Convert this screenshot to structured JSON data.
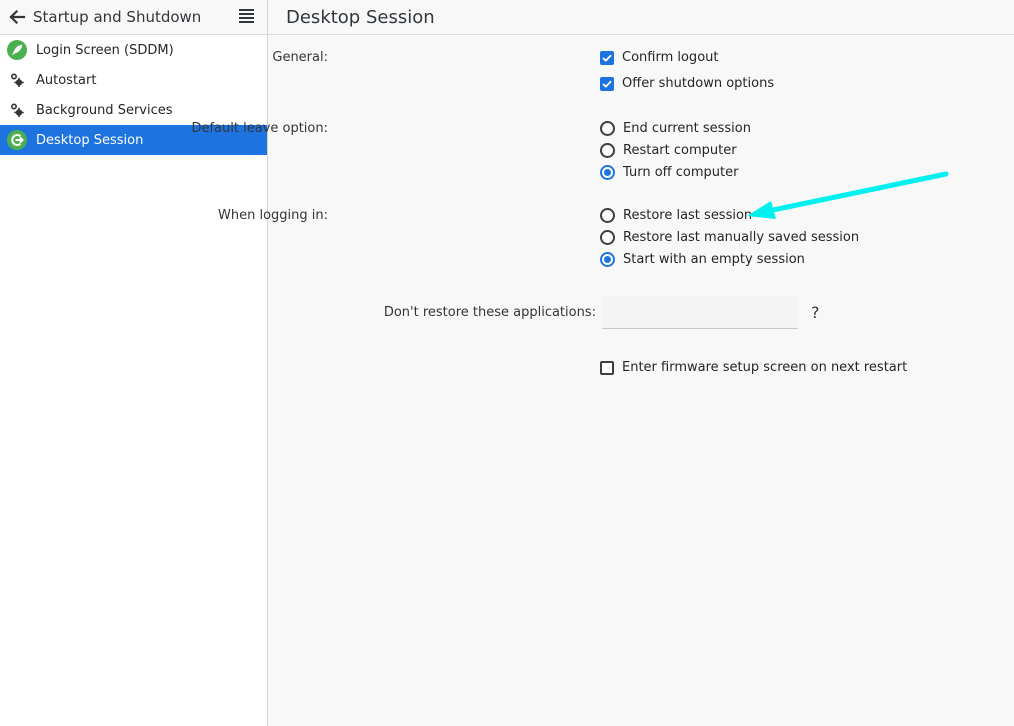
{
  "sidebar": {
    "title": "Startup and Shutdown",
    "back_icon": "arrow-left-icon",
    "menu_icon": "hamburger-menu-icon",
    "items": [
      {
        "label": "Login Screen (SDDM)",
        "icon": "rocket-icon",
        "active": false
      },
      {
        "label": "Autostart",
        "icon": "gears-icon",
        "active": false
      },
      {
        "label": "Background Services",
        "icon": "gears-icon",
        "active": false
      },
      {
        "label": "Desktop Session",
        "icon": "logout-icon",
        "active": true
      }
    ]
  },
  "main": {
    "title": "Desktop Session",
    "general": {
      "label": "General:",
      "options": [
        {
          "label": "Confirm logout",
          "checked": true
        },
        {
          "label": "Offer shutdown options",
          "checked": true
        }
      ]
    },
    "default_leave": {
      "label": "Default leave option:",
      "options": [
        {
          "label": "End current session",
          "selected": false
        },
        {
          "label": "Restart computer",
          "selected": false
        },
        {
          "label": "Turn off computer",
          "selected": true
        }
      ]
    },
    "when_logging_in": {
      "label": "When logging in:",
      "options": [
        {
          "label": "Restore last session",
          "selected": false
        },
        {
          "label": "Restore last manually saved session",
          "selected": false
        },
        {
          "label": "Start with an empty session",
          "selected": true
        }
      ]
    },
    "dont_restore": {
      "label": "Don't restore these applications:",
      "value": "",
      "help": "?"
    },
    "firmware": {
      "label": "Enter firmware setup screen on next restart",
      "checked": false
    }
  },
  "colors": {
    "accent": "#1d74e0",
    "annotation_arrow": "#00f0f0",
    "sidebar_icon_green": "#4caf50"
  }
}
